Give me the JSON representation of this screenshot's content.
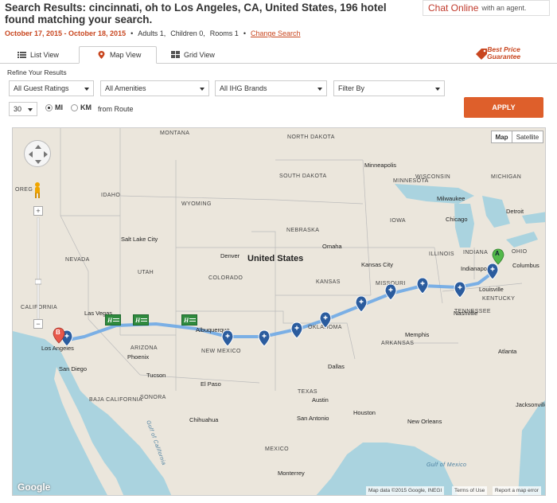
{
  "header": {
    "title": "Search Results: cincinnati, oh to Los Angeles, CA, United States, 196 hotel found matching your search.",
    "chat_label": "Chat Online",
    "chat_sub": "with an agent."
  },
  "stay": {
    "dates": "October 17, 2015 - October 18, 2015",
    "adults": "Adults 1,",
    "children": "Children 0,",
    "rooms": "Rooms 1",
    "change_search": "Change Search"
  },
  "tabs": [
    {
      "label": "List View",
      "icon": "list-icon"
    },
    {
      "label": "Map View",
      "icon": "map-pin-icon"
    },
    {
      "label": "Grid View",
      "icon": "grid-icon"
    }
  ],
  "best_price": {
    "line1": "Best Price",
    "line2": "Guarantee"
  },
  "refine": {
    "label": "Refine Your Results",
    "filters": [
      "All Guest Ratings",
      "All Amenities",
      "All IHG Brands",
      "Filter By"
    ],
    "distance": "30",
    "unit_mi": "MI",
    "unit_km": "KM",
    "from_route": "from Route",
    "apply": "APPLY"
  },
  "map": {
    "type_map": "Map",
    "type_satellite": "Satellite",
    "country_label": "United States",
    "google": "Google",
    "attribution": "Map data ©2015 Google, INEGI",
    "terms": "Terms of Use",
    "report": "Report a map error",
    "marker_start": "A",
    "marker_end": "B",
    "states": [
      "MONTANA",
      "NORTH DAKOTA",
      "MINNESOTA",
      "SOUTH DAKOTA",
      "WISCONSIN",
      "IDAHO",
      "WYOMING",
      "IOWA",
      "MICHIGAN",
      "NEBRASKA",
      "NEVADA",
      "UTAH",
      "COLORADO",
      "KANSAS",
      "ILLINOIS",
      "INDIANA",
      "OHIO",
      "MISSOURI",
      "KENTUCKY",
      "CALIFORNIA",
      "ARIZONA",
      "NEW MEXICO",
      "OKLAHOMA",
      "TENNESSEE",
      "ARKANSAS",
      "TEXAS",
      "BAJA CALIFORNIA",
      "MEXICO",
      "SONORA",
      "OREG"
    ],
    "cities": [
      "Minneapolis",
      "Milwaukee",
      "Detroit",
      "Chicago",
      "Salt Lake City",
      "Denver",
      "Omaha",
      "Kansas City",
      "Indianapolis",
      "Columbus",
      "Louisville",
      "Nashville",
      "Memphis",
      "Atlanta",
      "Las Vegas",
      "Los Angeles",
      "San Diego",
      "Phoenix",
      "Tucson",
      "Albuquerque",
      "El Paso",
      "Dallas",
      "Houston",
      "San Antonio",
      "Austin",
      "New Orleans",
      "Jacksonville",
      "Chihuahua",
      "Monterrey",
      "Gulf of California",
      "Gulf of Mexico"
    ]
  },
  "colors": {
    "accent": "#c8461f",
    "apply": "#de5f2b",
    "route": "#6ea8e6",
    "pin": "#2b5c9e",
    "hotel_green": "#2f8a3e"
  }
}
